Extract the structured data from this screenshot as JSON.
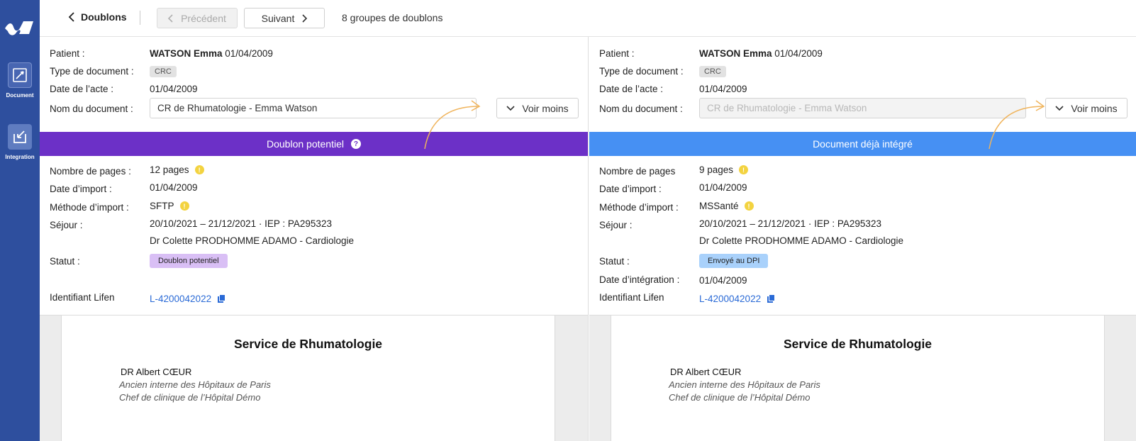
{
  "sidebar": {
    "items": [
      {
        "label": "Document",
        "icon": "document-edit-icon"
      },
      {
        "label": "Integration",
        "icon": "integration-arrow-icon"
      }
    ]
  },
  "topbar": {
    "back_label": "Doublons",
    "prev_label": "Précédent",
    "next_label": "Suivant",
    "groups_label": "8 groupes de doublons"
  },
  "left": {
    "patient_label": "Patient :",
    "patient_name": "WATSON Emma",
    "patient_dob": "01/04/2009",
    "type_label": "Type de document :",
    "type_value": "CRC",
    "acte_label": "Date de l’acte :",
    "acte_value": "01/04/2009",
    "docname_label": "Nom du document :",
    "docname_value": "CR de Rhumatologie - Emma Watson",
    "more_label": "Voir moins",
    "banner_label": "Doublon potentiel",
    "banner_color": "#6c30c7",
    "pages_label": "Nombre de pages :",
    "pages_value": "12 pages",
    "import_date_label": "Date d’import :",
    "import_date_value": "01/04/2009",
    "method_label": "Méthode d’import :",
    "method_value": "SFTP",
    "sejour_label": "Séjour :",
    "sejour_value": "20/10/2021 – 21/12/2021 · IEP : PA295323",
    "doctor_value": "Dr Colette PRODHOMME ADAMO - Cardiologie",
    "status_label": "Statut :",
    "status_value": "Doublon potentiel",
    "id_label": "Identifiant Lifen",
    "id_value": "L-4200042022"
  },
  "right": {
    "patient_label": "Patient :",
    "patient_name": "WATSON Emma",
    "patient_dob": "01/04/2009",
    "type_label": "Type de document :",
    "type_value": "CRC",
    "acte_label": "Date de l’acte :",
    "acte_value": "01/04/2009",
    "docname_label": "Nom du document :",
    "docname_value": "CR de Rhumatologie - Emma Watson",
    "more_label": "Voir moins",
    "banner_label": "Document déjà intégré",
    "banner_color": "#4690f3",
    "pages_label": "Nombre de pages",
    "pages_value": "9 pages",
    "import_date_label": "Date d’import :",
    "import_date_value": "01/04/2009",
    "method_label": "Méthode d’import :",
    "method_value": "MSSanté",
    "sejour_label": "Séjour :",
    "sejour_value": "20/10/2021 – 21/12/2021 · IEP : PA295323",
    "doctor_value": "Dr Colette PRODHOMME ADAMO - Cardiologie",
    "status_label": "Statut :",
    "status_value": "Envoyé au DPI",
    "integration_date_label": "Date d’intégration :",
    "integration_date_value": "01/04/2009",
    "id_label": "Identifiant Lifen",
    "id_value": "L-4200042022"
  },
  "preview": {
    "title": "Service de Rhumatologie",
    "doctor": "DR Albert CŒUR",
    "line1": "Ancien interne des Hôpitaux de Paris",
    "line2": "Chef de clinique de l’Hôpital Démo"
  }
}
